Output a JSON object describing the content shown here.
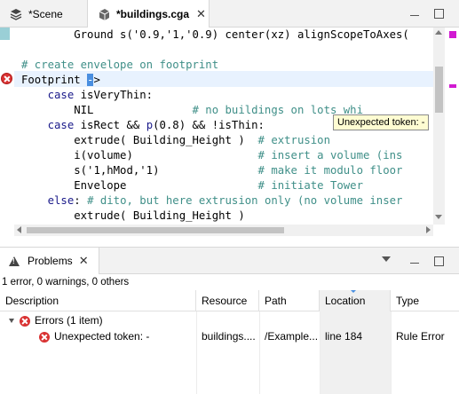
{
  "editor_tabs": [
    {
      "label": "*Scene",
      "icon": "layers-icon",
      "active": false
    },
    {
      "label": "*buildings.cga",
      "icon": "cga-file-icon",
      "active": true,
      "close": "✕"
    }
  ],
  "code_lines": [
    {
      "indent": "        ",
      "parts": [
        {
          "t": "Ground s('0.9,'1,'0.9) center(xz) alignScopeToAxes(",
          "c": ""
        }
      ]
    },
    {
      "indent": "",
      "parts": [
        {
          "t": "",
          "c": ""
        }
      ]
    },
    {
      "indent": "",
      "parts": [
        {
          "t": "# create envelope on footprint",
          "c": "cm"
        }
      ]
    },
    {
      "indent": "",
      "parts": [
        {
          "t": "Footprint ",
          "c": ""
        }
      ]
    },
    {
      "indent": "    ",
      "parts": [
        {
          "t": "case",
          "c": "kw"
        },
        {
          "t": " isVeryThin:",
          "c": ""
        }
      ]
    },
    {
      "indent": "        ",
      "parts": [
        {
          "t": "NIL               ",
          "c": ""
        },
        {
          "t": "# no buildings on lots whi",
          "c": "cm"
        }
      ]
    },
    {
      "indent": "    ",
      "parts": [
        {
          "t": "case",
          "c": "kw"
        },
        {
          "t": " isRect && ",
          "c": ""
        },
        {
          "t": "p",
          "c": "kw"
        },
        {
          "t": "(0.8) && !isThin:",
          "c": ""
        }
      ]
    },
    {
      "indent": "        ",
      "parts": [
        {
          "t": "extrude( Building_Height )  ",
          "c": ""
        },
        {
          "t": "# extrusion",
          "c": "cm"
        }
      ]
    },
    {
      "indent": "        ",
      "parts": [
        {
          "t": "i(volume)                   ",
          "c": ""
        },
        {
          "t": "# insert a volume (ins",
          "c": "cm"
        }
      ]
    },
    {
      "indent": "        ",
      "parts": [
        {
          "t": "s('1,hMod,'1)               ",
          "c": ""
        },
        {
          "t": "# make it modulo floor",
          "c": "cm"
        }
      ]
    },
    {
      "indent": "        ",
      "parts": [
        {
          "t": "Envelope                    ",
          "c": ""
        },
        {
          "t": "# initiate Tower",
          "c": "cm"
        }
      ]
    },
    {
      "indent": "    ",
      "parts": [
        {
          "t": "else",
          "c": "kw"
        },
        {
          "t": ": ",
          "c": ""
        },
        {
          "t": "# dito, but here extrusion only (no volume inser",
          "c": "cm"
        }
      ]
    },
    {
      "indent": "        ",
      "parts": [
        {
          "t": "extrude( Building_Height )",
          "c": ""
        }
      ]
    }
  ],
  "selected_arrow": "->",
  "tooltip": "Unexpected token: -",
  "problems": {
    "tab_label": "Problems",
    "tab_close": "✕",
    "summary": "1 error, 0 warnings, 0 others",
    "columns": [
      "Description",
      "Resource",
      "Path",
      "Location",
      "Type"
    ],
    "group_label": "Errors (1 item)",
    "rows": [
      {
        "description": "Unexpected token: -",
        "resource": "buildings....",
        "path": "/Example...",
        "location": "line 184",
        "type": "Rule Error"
      }
    ]
  },
  "colors": {
    "comment": "#3f8f88",
    "keyword": "#1a1a8a",
    "error": "#d93232",
    "selection": "#4a8fe0",
    "current_line": "#e8f2fe",
    "annotation": "#d11ad1"
  }
}
